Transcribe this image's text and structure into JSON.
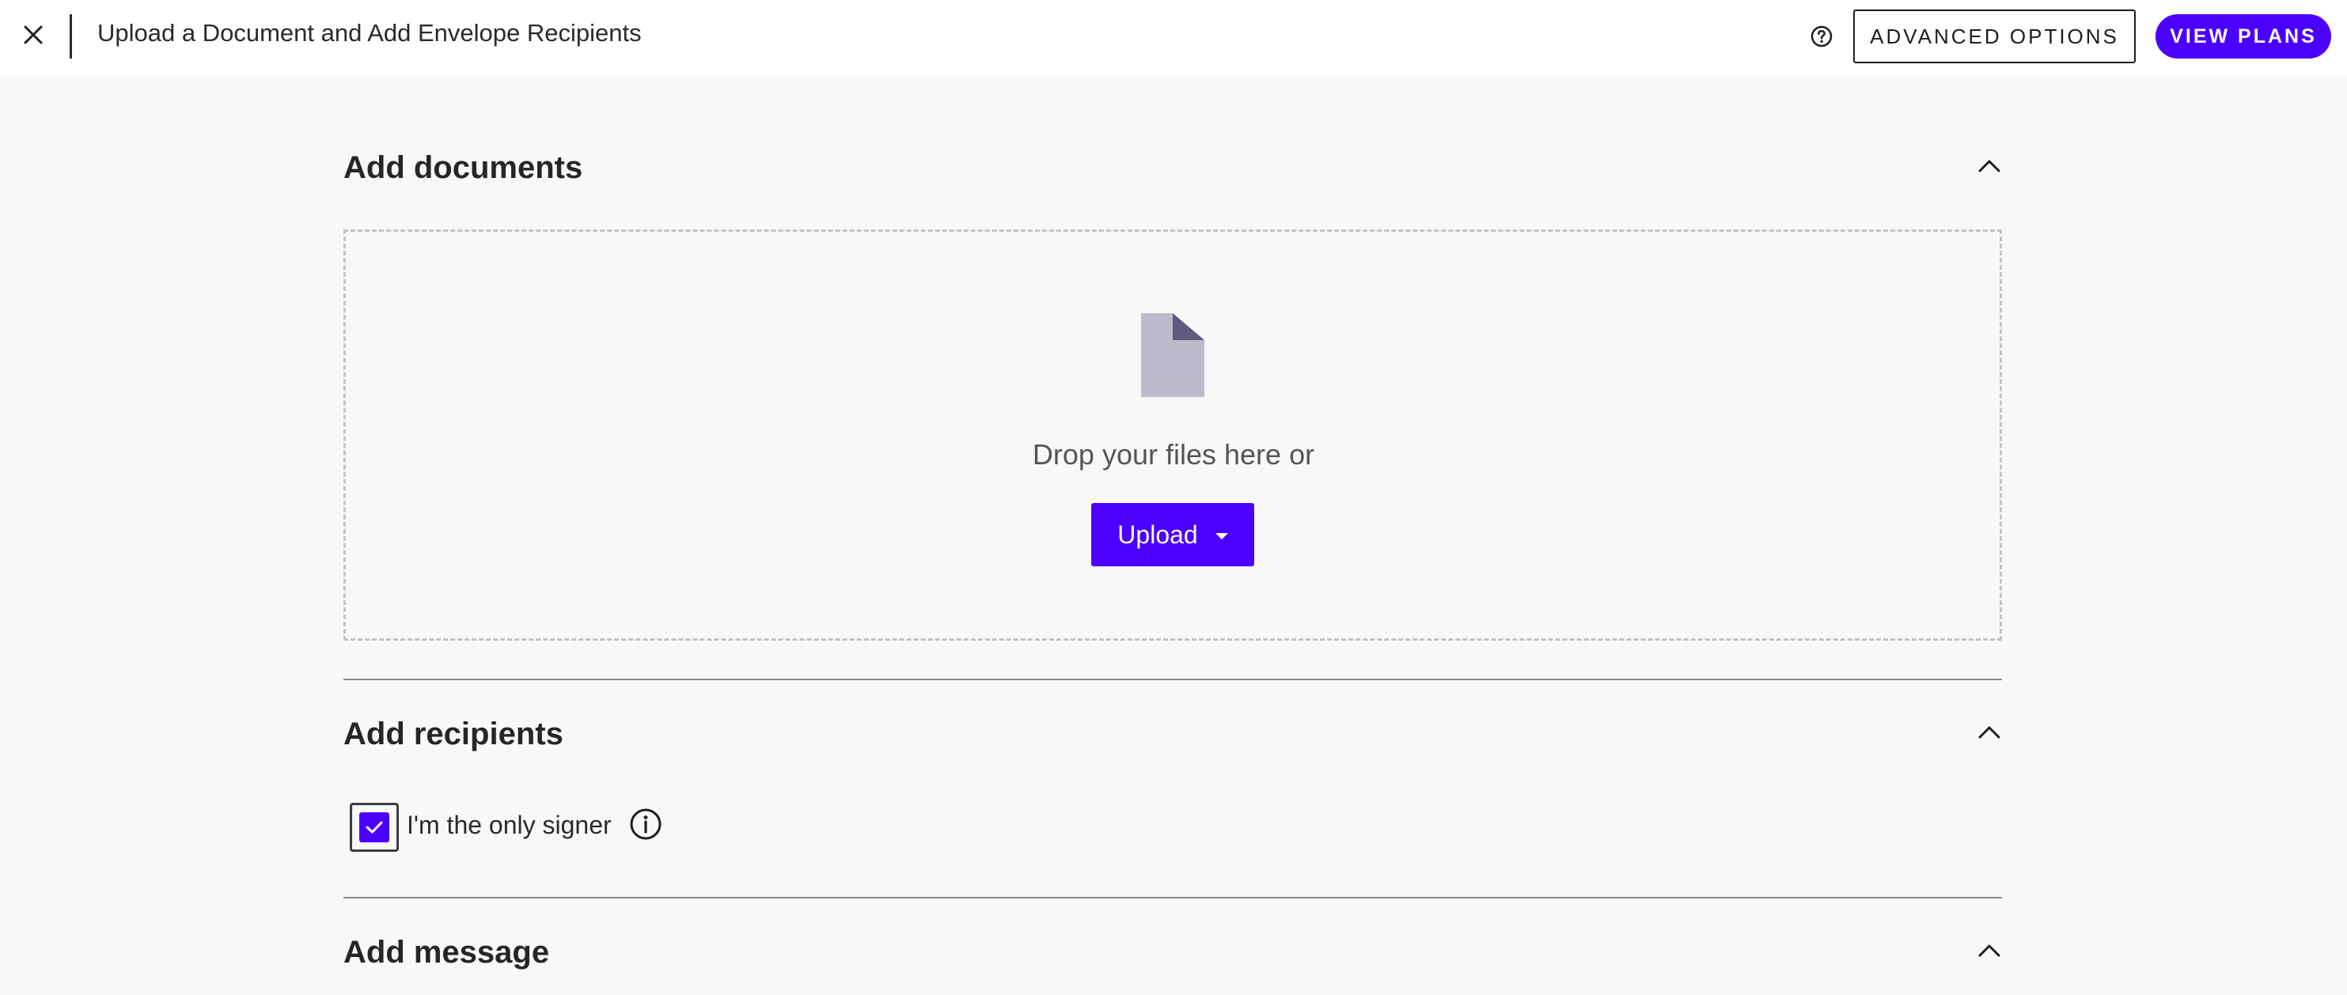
{
  "header": {
    "title": "Upload a Document and Add Envelope Recipients",
    "close_icon": "close-icon",
    "help_icon": "help-circle-icon",
    "advanced_options_label": "ADVANCED OPTIONS",
    "view_plans_label": "VIEW PLANS"
  },
  "documents": {
    "title": "Add documents",
    "toggle_icon": "chevron-up-icon",
    "drop_text": "Drop your files here or",
    "upload_label": "Upload",
    "file_icon": "document-icon"
  },
  "recipients": {
    "title": "Add recipients",
    "toggle_icon": "chevron-up-icon",
    "only_signer_label": "I'm the only signer",
    "only_signer_checked": true,
    "info_icon": "info-icon"
  },
  "message": {
    "title": "Add message",
    "toggle_icon": "chevron-up-icon"
  },
  "colors": {
    "accent": "#4c00ff",
    "background": "#f8f8f8",
    "header_bg": "#ffffff",
    "doc_icon_body": "#bdbbc9",
    "doc_icon_fold": "#5e5a7a"
  }
}
